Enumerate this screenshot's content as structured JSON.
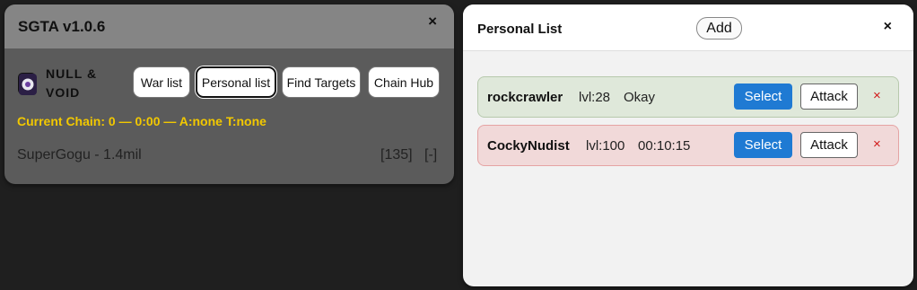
{
  "sgta": {
    "title": "SGTA v1.0.6",
    "close_label": "×",
    "faction": {
      "logo_icon": "null-and-void-logo",
      "name": "NULL & VOID"
    },
    "nav": [
      {
        "label": "War list",
        "active": false
      },
      {
        "label": "Personal list",
        "active": true
      },
      {
        "label": "Find Targets",
        "active": false
      },
      {
        "label": "Chain Hub",
        "active": false
      }
    ],
    "chain_status": "Current Chain: 0 — 0:00 — A:none T:none",
    "row": {
      "name": "SuperGogu - 1.4mil",
      "count": "[135]",
      "remove": "[-]"
    }
  },
  "personal_list": {
    "title": "Personal List",
    "add_label": "Add",
    "close_label": "×",
    "targets": [
      {
        "name": "rockcrawler",
        "level": "lvl:28",
        "status": "Okay",
        "select_label": "Select",
        "attack_label": "Attack",
        "remove_label": "×",
        "state": "okay"
      },
      {
        "name": "CockyNudist",
        "level": "lvl:100",
        "status": "00:10:15",
        "select_label": "Select",
        "attack_label": "Attack",
        "remove_label": "×",
        "state": "hospital"
      }
    ]
  },
  "colors": {
    "accent_blue": "#1f7ad3",
    "chain_yellow": "#f2c800",
    "okay_bg": "#dfe8da",
    "hospital_bg": "#f1d9d9",
    "remove_red": "#d11a1a"
  }
}
